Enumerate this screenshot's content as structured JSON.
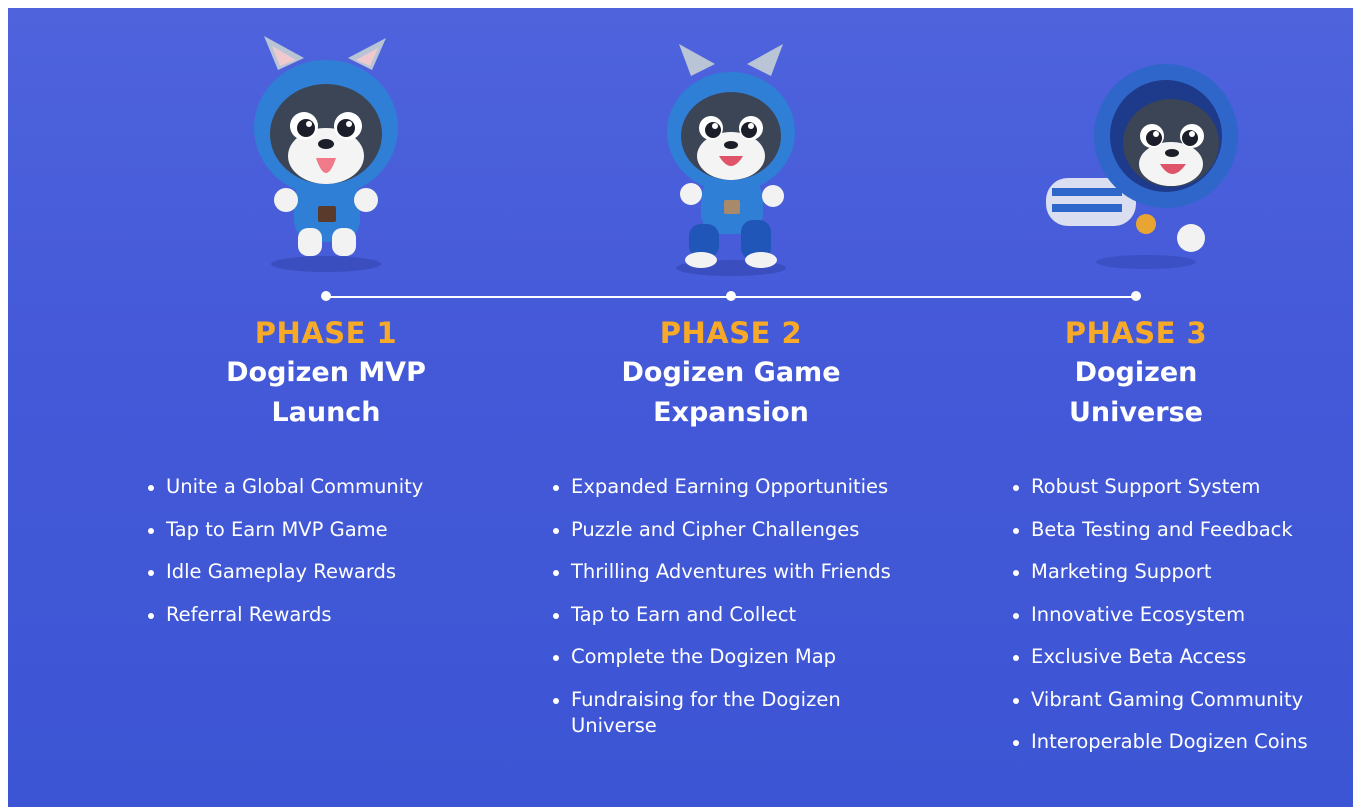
{
  "phases": [
    {
      "label": "PHASE 1",
      "title": "Dogizen MVP Launch",
      "mascot": "hooded-dog-tongue-out",
      "items": [
        "Unite a Global Community",
        "Tap to Earn MVP Game",
        "Idle Gameplay Rewards",
        "Referral Rewards"
      ]
    },
    {
      "label": "PHASE 2",
      "title": "Dogizen Game Expansion",
      "mascot": "hooded-dog-walking",
      "items": [
        "Expanded Earning Opportunities",
        "Puzzle and Cipher Challenges",
        "Thrilling Adventures with Friends",
        "Tap to Earn and Collect",
        "Complete the Dogizen Map",
        "Fundraising for the Dogizen Universe"
      ]
    },
    {
      "label": "PHASE 3",
      "title": "Dogizen Universe",
      "mascot": "astronaut-dog-flying",
      "items": [
        "Robust Support System",
        "Beta Testing and Feedback",
        "Marketing Support",
        "Innovative Ecosystem",
        "Exclusive Beta Access",
        "Vibrant Gaming Community",
        "Interoperable Dogizen Coins"
      ]
    }
  ],
  "colors": {
    "background": "#4a5fdb",
    "phase_label": "#f7a928",
    "text": "#ffffff"
  }
}
